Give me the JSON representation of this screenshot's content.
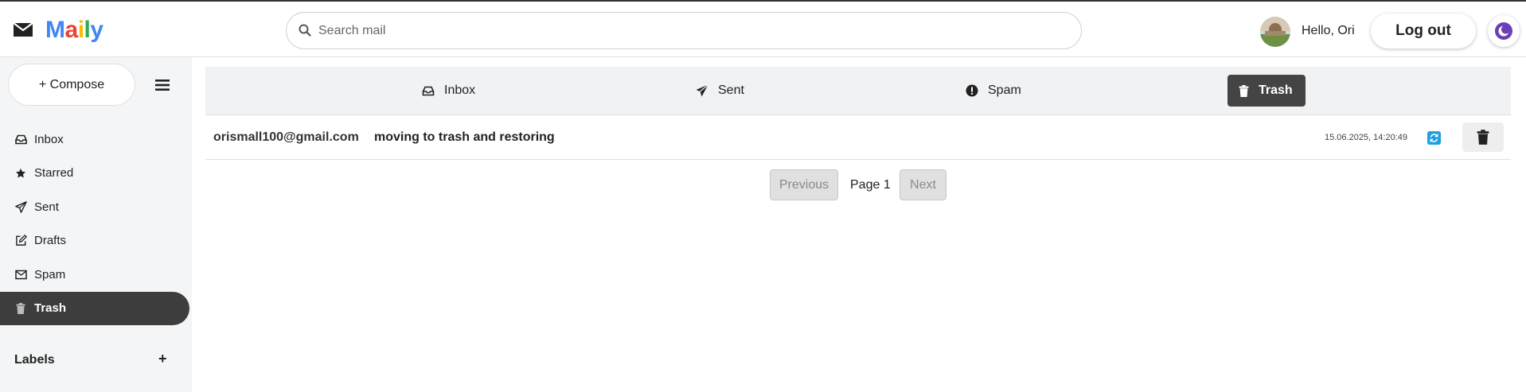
{
  "app": {
    "name": "Maily",
    "logo_letters": [
      {
        "ch": "M",
        "color": "#4285F4"
      },
      {
        "ch": "a",
        "color": "#EA4335"
      },
      {
        "ch": "i",
        "color": "#FBBC05"
      },
      {
        "ch": "l",
        "color": "#34A853"
      },
      {
        "ch": "y",
        "color": "#4285F4"
      }
    ]
  },
  "header": {
    "search_placeholder": "Search mail",
    "greeting": "Hello, Ori",
    "logout_label": "Log out"
  },
  "sidebar": {
    "compose_label": "+ Compose",
    "items": [
      {
        "label": "Inbox",
        "icon": "inbox-icon"
      },
      {
        "label": "Starred",
        "icon": "star-icon"
      },
      {
        "label": "Sent",
        "icon": "paper-plane-icon"
      },
      {
        "label": "Drafts",
        "icon": "edit-icon"
      },
      {
        "label": "Spam",
        "icon": "envelope-icon"
      },
      {
        "label": "Trash",
        "icon": "trash-icon",
        "active": true
      }
    ],
    "labels_heading": "Labels",
    "labels_add": "+"
  },
  "tabs": [
    {
      "label": "Inbox",
      "icon": "inbox-icon"
    },
    {
      "label": "Sent",
      "icon": "paper-plane-icon"
    },
    {
      "label": "Spam",
      "icon": "exclamation-circle-icon"
    },
    {
      "label": "Trash",
      "icon": "trash-icon",
      "active": true
    }
  ],
  "emails": [
    {
      "sender": "orismall100@gmail.com",
      "subject": "moving to trash and restoring",
      "date": "15.06.2025, 14:20:49"
    }
  ],
  "pagination": {
    "previous_label": "Previous",
    "page_label": "Page 1",
    "next_label": "Next"
  },
  "colors": {
    "active_bg": "#3d3d3d",
    "restore_blue": "#1f9fe0",
    "theme_purple": "#6c3fb5"
  }
}
